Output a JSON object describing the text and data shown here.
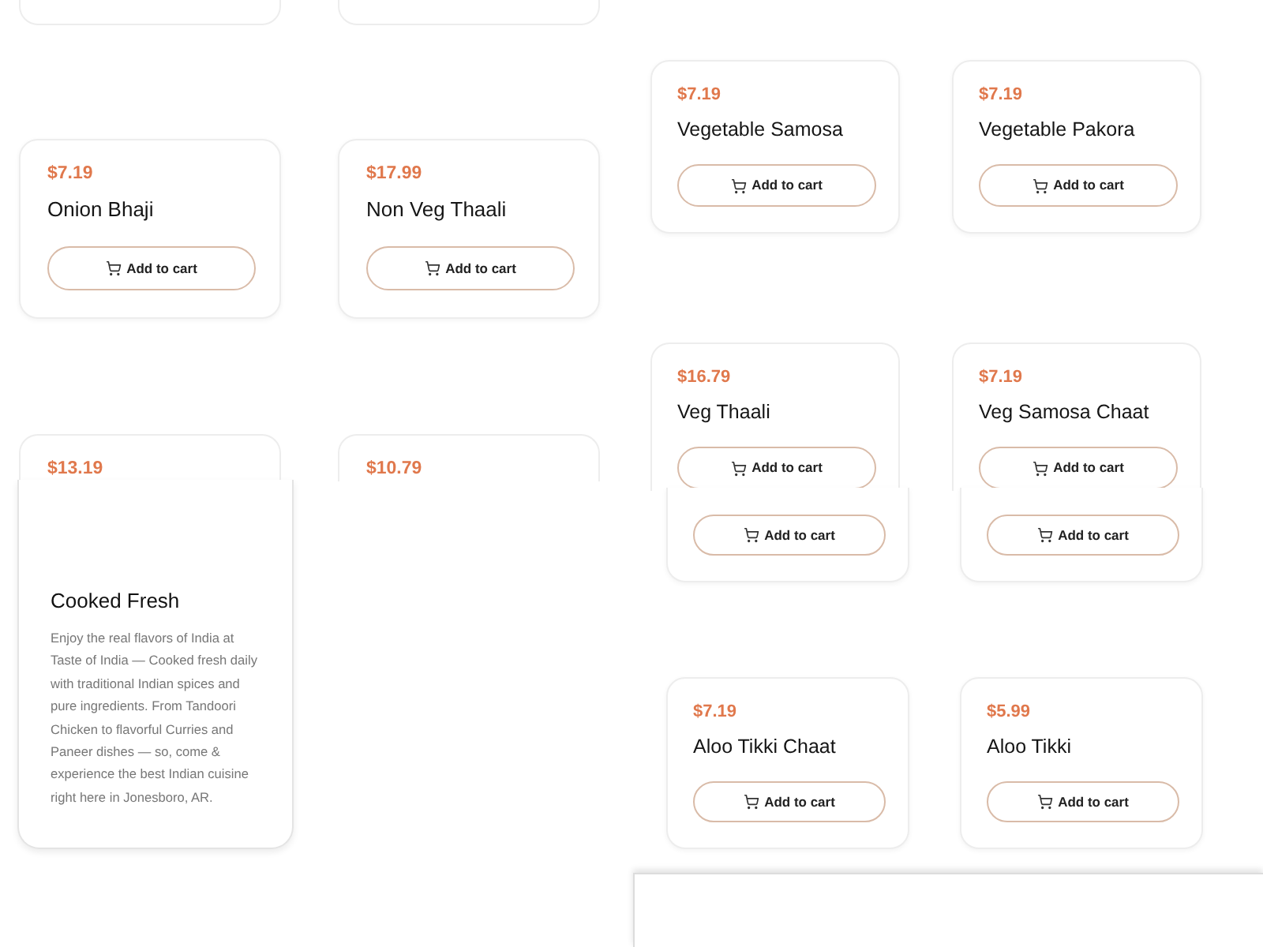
{
  "left_top_cards": [
    {
      "price": "$7.19",
      "name": "Onion Bhaji",
      "button": "Add to cart"
    },
    {
      "price": "$17.99",
      "name": "Non Veg Thaali",
      "button": "Add to cart"
    },
    {
      "price": "$13.19"
    },
    {
      "price": "$10.79"
    }
  ],
  "info_card": {
    "title": "Cooked Fresh",
    "text": "Enjoy the real flavors of India at Taste of India — Cooked fresh daily with traditional Indian spices and pure ingredients. From Tandoori Chicken to flavorful Curries and Paneer dishes — so, come & experience the best Indian cuisine right here in Jonesboro, AR."
  },
  "right_top_cards": [
    {
      "price": "$7.19",
      "name": "Vegetable Samosa",
      "button": "Add to cart"
    },
    {
      "price": "$7.19",
      "name": "Vegetable Pakora",
      "button": "Add to cart"
    },
    {
      "price": "$16.79",
      "name": "Veg Thaali",
      "button": "Add to cart"
    },
    {
      "price": "$7.19",
      "name": "Veg Samosa Chaat",
      "button": "Add to cart"
    }
  ],
  "right_lower_cards": [
    {
      "button": "Add to cart"
    },
    {
      "button": "Add to cart"
    },
    {
      "price": "$7.19",
      "name": "Aloo Tikki Chaat",
      "button": "Add to cart"
    },
    {
      "price": "$5.99",
      "name": "Aloo Tikki",
      "button": "Add to cart"
    }
  ]
}
